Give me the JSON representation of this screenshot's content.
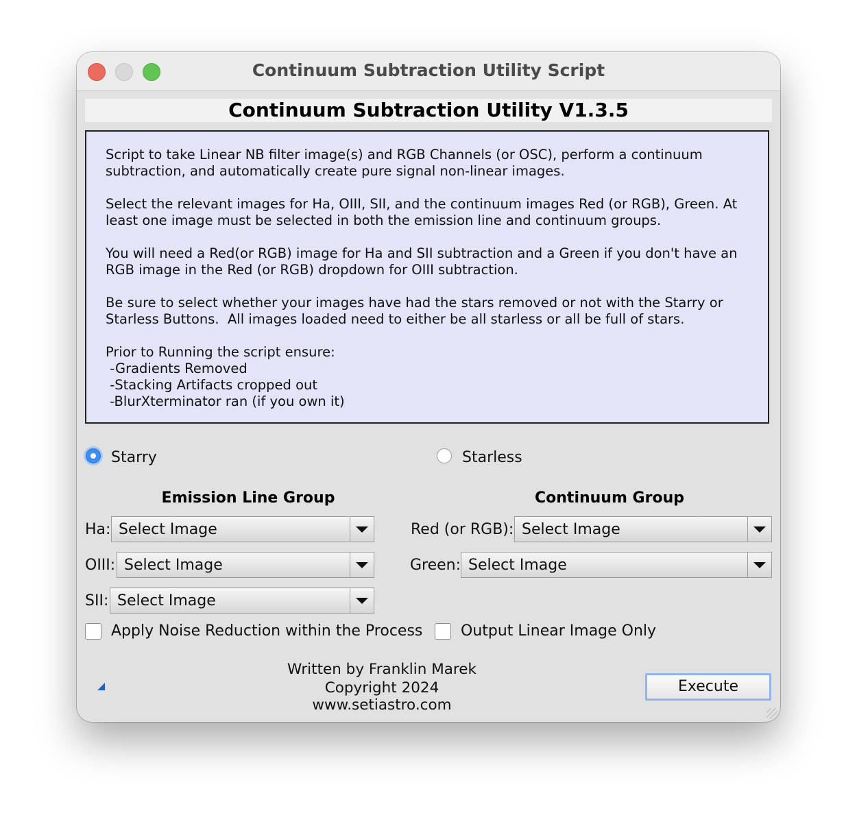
{
  "window": {
    "title": "Continuum Subtraction Utility Script"
  },
  "header": {
    "title": "Continuum Subtraction Utility V1.3.5"
  },
  "instructions": {
    "text": "Script to take Linear NB filter image(s) and RGB Channels (or OSC), perform a continuum\nsubtraction, and automatically create pure signal non-linear images.\n\nSelect the relevant images for Ha, OIII, SII, and the continuum images Red (or RGB), Green. At\nleast one image must be selected in both the emission line and continuum groups.\n\nYou will need a Red(or RGB) image for Ha and SII subtraction and a Green if you don't have an\nRGB image in the Red (or RGB) dropdown for OIII subtraction.\n\nBe sure to select whether your images have had the stars removed or not with the Starry or\nStarless Buttons.  All images loaded need to either be all starless or all be full of stars.\n\nPrior to Running the script ensure:\n -Gradients Removed\n -Stacking Artifacts cropped out\n -BlurXterminator ran (if you own it)"
  },
  "star_mode": {
    "starry_label": "Starry",
    "starless_label": "Starless",
    "selected": "Starry"
  },
  "emission_group": {
    "title": "Emission Line Group",
    "ha_label": "Ha:",
    "oiii_label": "OIII:",
    "sii_label": "SII:",
    "ha_value": "Select Image",
    "oiii_value": "Select Image",
    "sii_value": "Select Image"
  },
  "continuum_group": {
    "title": "Continuum Group",
    "red_label": "Red (or RGB):",
    "green_label": "Green:",
    "red_value": "Select Image",
    "green_value": "Select Image"
  },
  "options": {
    "noise_reduction_label": "Apply Noise Reduction within the Process",
    "noise_reduction_checked": false,
    "linear_only_label": "Output Linear Image Only",
    "linear_only_checked": false
  },
  "footer": {
    "author": "Written by Franklin Marek",
    "copyright": "Copyright 2024",
    "website": "www.setiastro.com",
    "execute_label": "Execute"
  }
}
